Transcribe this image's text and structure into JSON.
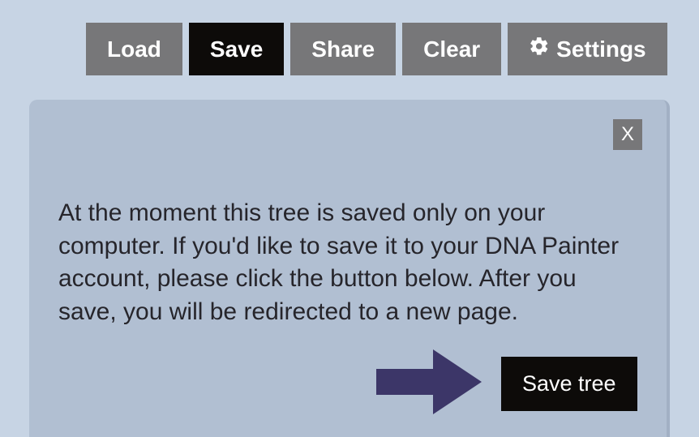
{
  "toolbar": {
    "load": "Load",
    "save": "Save",
    "share": "Share",
    "clear": "Clear",
    "settings": "Settings"
  },
  "panel": {
    "close": "X",
    "message": "At the moment this tree is saved only on your computer. If you'd like to save it to your DNA Painter account, please click the button below. After you save, you will be redirected to a new page.",
    "saveTree": "Save tree"
  },
  "colors": {
    "arrow": "#3c3668"
  }
}
